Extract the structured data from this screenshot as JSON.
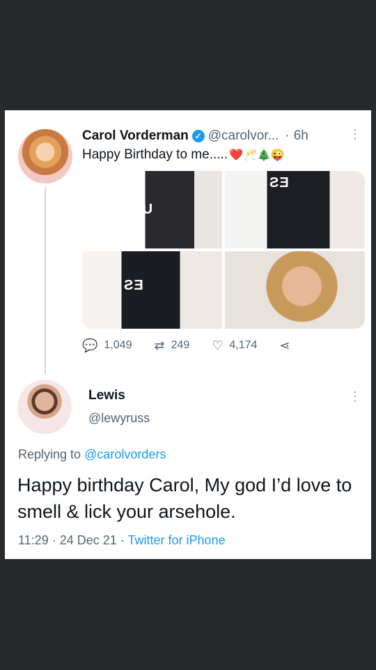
{
  "tweet": {
    "display_name": "Carol Vorderman",
    "handle": "@carolvor...",
    "separator": "·",
    "time": "6h",
    "text": "Happy Birthday to me.....",
    "emojis": "❤️🥂🎄😜",
    "photo_labels": [
      "ƧƎU",
      "ƧƎ",
      "ƧƎ"
    ],
    "stats": {
      "replies": "1,049",
      "retweets": "249",
      "likes": "4,174"
    },
    "icons": [
      "reply-icon",
      "retweet-icon",
      "like-icon",
      "share-icon"
    ]
  },
  "reply": {
    "display_name": "Lewis",
    "handle": "@lewyruss",
    "replying_prefix": "Replying to",
    "replying_to": "@carolvorders",
    "text": "Happy birthday Carol, My god I’d love to smell & lick your arsehole.",
    "time": "11:29",
    "date": "24 Dec 21",
    "separator": "·",
    "source": "Twitter for iPhone"
  },
  "colors": {
    "background": "#272a2d",
    "card": "#ffffff",
    "link": "#1d9bf0",
    "muted": "#536471",
    "verified": "#1d9bf0"
  }
}
